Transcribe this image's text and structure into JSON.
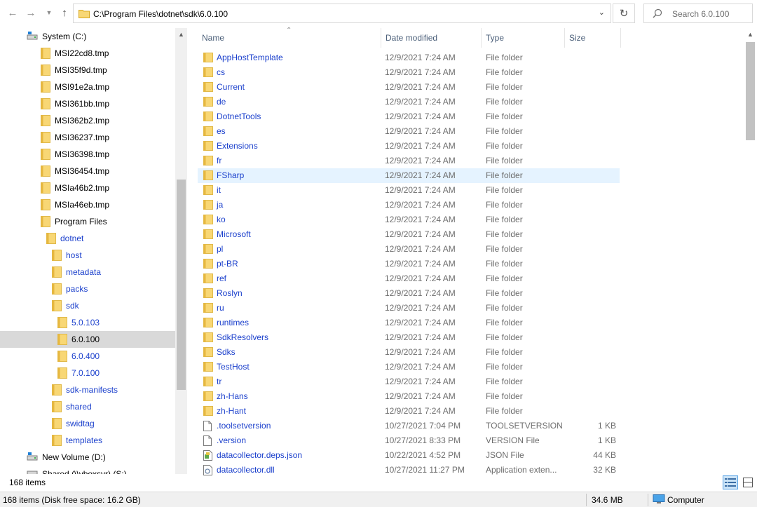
{
  "address_bar": {
    "path": "C:\\Program Files\\dotnet\\sdk\\6.0.100",
    "search_placeholder": "Search 6.0.100"
  },
  "navigation": [
    {
      "label": "System (C:)",
      "icon": "drive-icon",
      "indent": 0,
      "color": "normal"
    },
    {
      "label": "MSI22cd8.tmp",
      "icon": "folder-icon",
      "indent": 1,
      "color": "normal"
    },
    {
      "label": "MSI35f9d.tmp",
      "icon": "folder-icon",
      "indent": 1,
      "color": "normal"
    },
    {
      "label": "MSI91e2a.tmp",
      "icon": "folder-icon",
      "indent": 1,
      "color": "normal"
    },
    {
      "label": "MSI361bb.tmp",
      "icon": "folder-icon",
      "indent": 1,
      "color": "normal"
    },
    {
      "label": "MSI362b2.tmp",
      "icon": "folder-icon",
      "indent": 1,
      "color": "normal"
    },
    {
      "label": "MSI36237.tmp",
      "icon": "folder-icon",
      "indent": 1,
      "color": "normal"
    },
    {
      "label": "MSI36398.tmp",
      "icon": "folder-icon",
      "indent": 1,
      "color": "normal"
    },
    {
      "label": "MSI36454.tmp",
      "icon": "folder-icon",
      "indent": 1,
      "color": "normal"
    },
    {
      "label": "MSIa46b2.tmp",
      "icon": "folder-icon",
      "indent": 1,
      "color": "normal"
    },
    {
      "label": "MSIa46eb.tmp",
      "icon": "folder-icon",
      "indent": 1,
      "color": "normal"
    },
    {
      "label": "Program Files",
      "icon": "folder-icon",
      "indent": 1,
      "color": "normal"
    },
    {
      "label": "dotnet",
      "icon": "folder-icon",
      "indent": 2,
      "color": "blue"
    },
    {
      "label": "host",
      "icon": "folder-icon",
      "indent": 3,
      "color": "blue"
    },
    {
      "label": "metadata",
      "icon": "folder-icon",
      "indent": 3,
      "color": "blue"
    },
    {
      "label": "packs",
      "icon": "folder-icon",
      "indent": 3,
      "color": "blue"
    },
    {
      "label": "sdk",
      "icon": "folder-icon",
      "indent": 3,
      "color": "blue"
    },
    {
      "label": "5.0.103",
      "icon": "folder-icon",
      "indent": 4,
      "color": "blue"
    },
    {
      "label": "6.0.100",
      "icon": "folder-icon",
      "indent": 4,
      "color": "normal",
      "selected": true
    },
    {
      "label": "6.0.400",
      "icon": "folder-icon",
      "indent": 4,
      "color": "blue"
    },
    {
      "label": "7.0.100",
      "icon": "folder-icon",
      "indent": 4,
      "color": "blue"
    },
    {
      "label": "sdk-manifests",
      "icon": "folder-icon",
      "indent": 3,
      "color": "blue"
    },
    {
      "label": "shared",
      "icon": "folder-icon",
      "indent": 3,
      "color": "blue"
    },
    {
      "label": "swidtag",
      "icon": "folder-icon",
      "indent": 3,
      "color": "blue"
    },
    {
      "label": "templates",
      "icon": "folder-icon",
      "indent": 3,
      "color": "blue"
    },
    {
      "label": "New Volume (D:)",
      "icon": "drive-icon",
      "indent": 0,
      "color": "normal"
    },
    {
      "label": "Shared (\\\\vboxsvr) (S:)",
      "icon": "network-drive-icon",
      "indent": 0,
      "color": "normal"
    }
  ],
  "columns": {
    "name": "Name",
    "date": "Date modified",
    "type": "Type",
    "size": "Size"
  },
  "files": [
    {
      "name": "AppHostTemplate",
      "date": "12/9/2021 7:24 AM",
      "type": "File folder",
      "size": "",
      "icon": "folder-icon"
    },
    {
      "name": "cs",
      "date": "12/9/2021 7:24 AM",
      "type": "File folder",
      "size": "",
      "icon": "folder-icon"
    },
    {
      "name": "Current",
      "date": "12/9/2021 7:24 AM",
      "type": "File folder",
      "size": "",
      "icon": "folder-icon"
    },
    {
      "name": "de",
      "date": "12/9/2021 7:24 AM",
      "type": "File folder",
      "size": "",
      "icon": "folder-icon"
    },
    {
      "name": "DotnetTools",
      "date": "12/9/2021 7:24 AM",
      "type": "File folder",
      "size": "",
      "icon": "folder-icon"
    },
    {
      "name": "es",
      "date": "12/9/2021 7:24 AM",
      "type": "File folder",
      "size": "",
      "icon": "folder-icon"
    },
    {
      "name": "Extensions",
      "date": "12/9/2021 7:24 AM",
      "type": "File folder",
      "size": "",
      "icon": "folder-icon"
    },
    {
      "name": "fr",
      "date": "12/9/2021 7:24 AM",
      "type": "File folder",
      "size": "",
      "icon": "folder-icon"
    },
    {
      "name": "FSharp",
      "date": "12/9/2021 7:24 AM",
      "type": "File folder",
      "size": "",
      "icon": "folder-icon",
      "hover": true
    },
    {
      "name": "it",
      "date": "12/9/2021 7:24 AM",
      "type": "File folder",
      "size": "",
      "icon": "folder-icon"
    },
    {
      "name": "ja",
      "date": "12/9/2021 7:24 AM",
      "type": "File folder",
      "size": "",
      "icon": "folder-icon"
    },
    {
      "name": "ko",
      "date": "12/9/2021 7:24 AM",
      "type": "File folder",
      "size": "",
      "icon": "folder-icon"
    },
    {
      "name": "Microsoft",
      "date": "12/9/2021 7:24 AM",
      "type": "File folder",
      "size": "",
      "icon": "folder-icon"
    },
    {
      "name": "pl",
      "date": "12/9/2021 7:24 AM",
      "type": "File folder",
      "size": "",
      "icon": "folder-icon"
    },
    {
      "name": "pt-BR",
      "date": "12/9/2021 7:24 AM",
      "type": "File folder",
      "size": "",
      "icon": "folder-icon"
    },
    {
      "name": "ref",
      "date": "12/9/2021 7:24 AM",
      "type": "File folder",
      "size": "",
      "icon": "folder-icon"
    },
    {
      "name": "Roslyn",
      "date": "12/9/2021 7:24 AM",
      "type": "File folder",
      "size": "",
      "icon": "folder-icon"
    },
    {
      "name": "ru",
      "date": "12/9/2021 7:24 AM",
      "type": "File folder",
      "size": "",
      "icon": "folder-icon"
    },
    {
      "name": "runtimes",
      "date": "12/9/2021 7:24 AM",
      "type": "File folder",
      "size": "",
      "icon": "folder-icon"
    },
    {
      "name": "SdkResolvers",
      "date": "12/9/2021 7:24 AM",
      "type": "File folder",
      "size": "",
      "icon": "folder-icon"
    },
    {
      "name": "Sdks",
      "date": "12/9/2021 7:24 AM",
      "type": "File folder",
      "size": "",
      "icon": "folder-icon"
    },
    {
      "name": "TestHost",
      "date": "12/9/2021 7:24 AM",
      "type": "File folder",
      "size": "",
      "icon": "folder-icon"
    },
    {
      "name": "tr",
      "date": "12/9/2021 7:24 AM",
      "type": "File folder",
      "size": "",
      "icon": "folder-icon"
    },
    {
      "name": "zh-Hans",
      "date": "12/9/2021 7:24 AM",
      "type": "File folder",
      "size": "",
      "icon": "folder-icon"
    },
    {
      "name": "zh-Hant",
      "date": "12/9/2021 7:24 AM",
      "type": "File folder",
      "size": "",
      "icon": "folder-icon"
    },
    {
      "name": ".toolsetversion",
      "date": "10/27/2021 7:04 PM",
      "type": "TOOLSETVERSION ...",
      "size": "1 KB",
      "icon": "file-icon"
    },
    {
      "name": ".version",
      "date": "10/27/2021 8:33 PM",
      "type": "VERSION File",
      "size": "1 KB",
      "icon": "file-icon"
    },
    {
      "name": "datacollector.deps.json",
      "date": "10/22/2021 4:52 PM",
      "type": "JSON File",
      "size": "44 KB",
      "icon": "json-file-icon"
    },
    {
      "name": "datacollector.dll",
      "date": "10/27/2021 11:27 PM",
      "type": "Application exten...",
      "size": "32 KB",
      "icon": "dll-file-icon"
    }
  ],
  "item_count": "168 items",
  "status": {
    "left": "168 items (Disk free space: 16.2 GB)",
    "size": "34.6 MB",
    "zone": "Computer"
  },
  "colors": {
    "link_blue": "#1a3fcc",
    "folder_yellow": "#f8d775",
    "folder_dark": "#e0a800",
    "hover_row": "#e5f3ff",
    "selected_nav": "#d9d9d9"
  }
}
